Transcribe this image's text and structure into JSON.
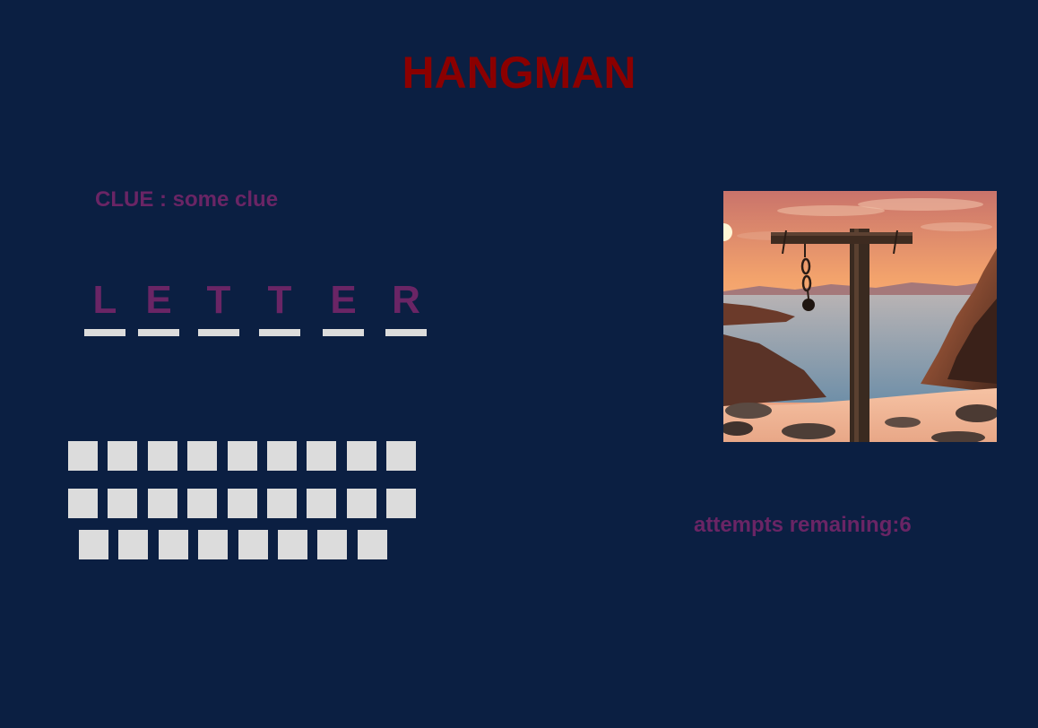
{
  "title": "HANGMAN",
  "clue": {
    "label": "CLUE :",
    "text": "some clue"
  },
  "word": [
    "L",
    "E",
    "T",
    "T",
    "E",
    "R"
  ],
  "keyboard": {
    "row1_count": 9,
    "row2_count": 9,
    "row3_count": 8
  },
  "attempts": {
    "label": "attempts remaining:",
    "value": "6"
  },
  "colors": {
    "background": "#0b1f42",
    "title": "#8b0000",
    "accent": "#6a2565",
    "key": "#dcdcdc"
  }
}
